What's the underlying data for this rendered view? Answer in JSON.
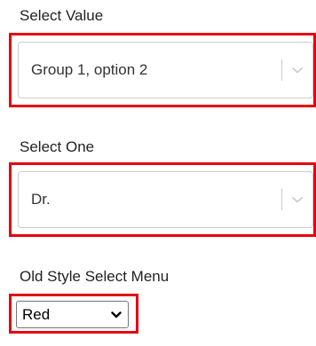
{
  "select_value": {
    "label": "Select Value",
    "selected": "Group 1, option 2"
  },
  "select_one": {
    "label": "Select One",
    "selected": "Dr."
  },
  "old_style_select": {
    "label": "Old Style Select Menu",
    "selected": "Red"
  },
  "icons": {
    "custom_dropdown": "chevron-down-icon",
    "native_dropdown": "caret-down-icon"
  },
  "colors": {
    "highlight_border": "#e60012",
    "control_border": "#cccccc",
    "indicator": "#cccccc"
  }
}
